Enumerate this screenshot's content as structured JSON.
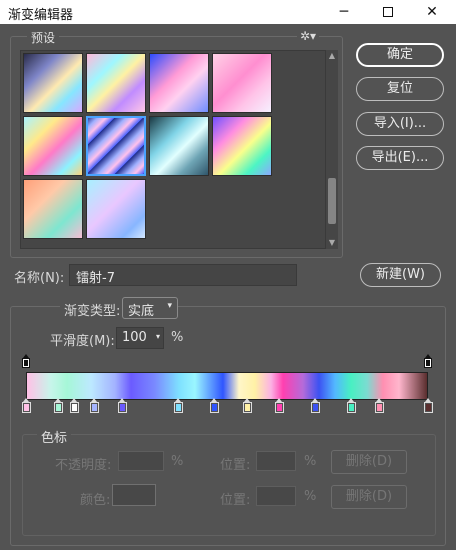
{
  "window": {
    "title": "渐变编辑器",
    "min_glyph": "─",
    "close_glyph": "✕"
  },
  "presets": {
    "label": "预设",
    "gear_glyph": "✲▾",
    "scroll_up": "▲",
    "scroll_down": "▼",
    "swatches": [
      {
        "gradient": "linear-gradient(135deg,#2a2c4a 0%,#7f86c9 30%,#ffe9b0 55%,#86e6ff 75%,#d9a8ff 100%)"
      },
      {
        "gradient": "linear-gradient(135deg,#ffb8d9 0%,#9ef7ff 30%,#fff1a2 50%,#c08cff 72%,#ffc7e7 100%)"
      },
      {
        "gradient": "linear-gradient(135deg,#2a4cff 0%,#ff9bd6 40%,#ffd1f0 60%,#6f8dff 100%)"
      },
      {
        "gradient": "linear-gradient(135deg,#ffd1e6 0%,#ff8ed0 45%,#ffc4e8 70%,#f6f0ff 100%)"
      },
      {
        "gradient": "linear-gradient(135deg,#a9f3ff 0%,#ffe98a 30%,#ff7ac7 55%,#8cf2ff 80%,#ffd17a 100%)"
      },
      {
        "gradient": "repeating-linear-gradient(135deg,#1d2a8a 0px,#9fb0ff 8px,#ffc1ec 14px,#4b63ff 20px)"
      },
      {
        "gradient": "linear-gradient(135deg,#1b3a44 0%,#7fd3e6 35%,#e2ffff 55%,#6fa5b5 75%,#2f556a 100%)"
      },
      {
        "gradient": "linear-gradient(135deg,#6f51ff 0%,#ff8de0 30%,#faff8c 55%,#4cf5c4 78%,#8ca8ff 100%)"
      },
      {
        "gradient": "linear-gradient(135deg,#ffa07a 0%,#ffc9a8 35%,#7ee6d0 70%,#f7bdd4 100%)"
      },
      {
        "gradient": "linear-gradient(135deg,#a8f0ff 0%,#e9c7ff 45%,#88b6ff 80%,#d4e8ff 100%)"
      }
    ],
    "selected_index": 5
  },
  "buttons": {
    "ok": "确定",
    "reset": "复位",
    "import": "导入(I)...",
    "export": "导出(E)...",
    "new": "新建(W)",
    "delete": "删除(D)"
  },
  "name": {
    "label": "名称(N):",
    "value": "镭射-7"
  },
  "gradient_type": {
    "label": "渐变类型:",
    "value": "实底",
    "chevron": "▾"
  },
  "smoothness": {
    "label": "平滑度(M):",
    "value": "100",
    "unit": "%",
    "chevron": "▾"
  },
  "opacity_stops": [
    {
      "position_pct": 0
    },
    {
      "position_pct": 100
    }
  ],
  "color_stops": [
    {
      "position_pct": 0,
      "color": "#ffc1e6"
    },
    {
      "position_pct": 8,
      "color": "#a6f7d7"
    },
    {
      "position_pct": 12,
      "color": "#ffffff"
    },
    {
      "position_pct": 17,
      "color": "#a3b3ff"
    },
    {
      "position_pct": 24,
      "color": "#6b5bff"
    },
    {
      "position_pct": 38,
      "color": "#7ee0ff"
    },
    {
      "position_pct": 47,
      "color": "#2f55ff"
    },
    {
      "position_pct": 55,
      "color": "#fff1a6"
    },
    {
      "position_pct": 63,
      "color": "#ff40b0"
    },
    {
      "position_pct": 72,
      "color": "#3c52f2"
    },
    {
      "position_pct": 81,
      "color": "#48f0c2"
    },
    {
      "position_pct": 88,
      "color": "#ff8fb1"
    },
    {
      "position_pct": 100,
      "color": "#5a2e2e"
    }
  ],
  "color_section": {
    "legend": "色标",
    "opacity_label": "不透明度:",
    "opacity_unit": "%",
    "location_label": "位置:",
    "location_unit": "%",
    "color_label": "颜色:",
    "location_label2": "位置:",
    "location_unit2": "%"
  }
}
